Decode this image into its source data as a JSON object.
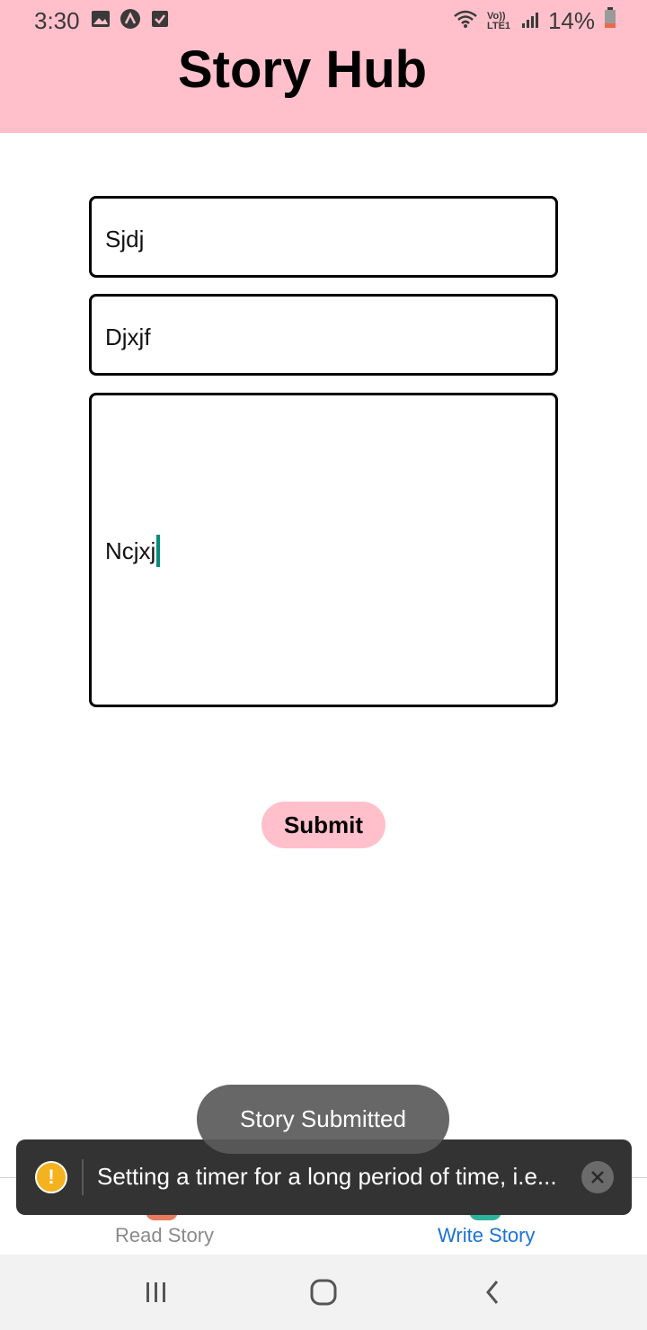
{
  "status_bar": {
    "time": "3:30",
    "left_icons": [
      "image-icon",
      "app-a-icon",
      "checkbox-icon"
    ],
    "network": "Vo)) LTE1",
    "battery": "14%",
    "battery_color": "#e86a4a"
  },
  "header": {
    "title": "Story Hub",
    "background": "#ffc0cb"
  },
  "form": {
    "title_value": "Sjdj",
    "author_value": "Djxjf",
    "story_value": "Ncjxj",
    "submit_label": "Submit"
  },
  "toast": {
    "message": "Story Submitted"
  },
  "warning": {
    "message": "Setting a timer for a long period of time, i.e..."
  },
  "tabs": [
    {
      "label": "Read Story",
      "active": false
    },
    {
      "label": "Write Story",
      "active": true
    }
  ],
  "colors": {
    "accent_pink": "#ffc0cb",
    "active_tab": "#1a73d6",
    "inactive_tab": "#8a8a8a",
    "caret": "#0a8a7a"
  }
}
